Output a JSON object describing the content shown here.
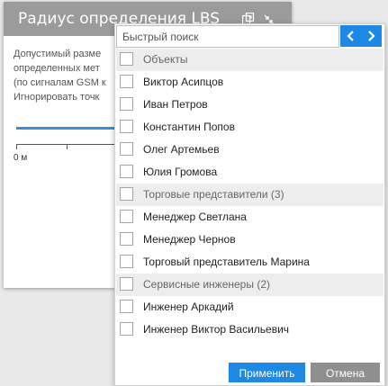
{
  "dialog": {
    "title": "Радиус определения LBS",
    "description_lines": [
      "Допустимый разме",
      "определенных мет",
      "(по сигналам GSM к",
      "Игнорировать точк"
    ],
    "scale_label": "0 м"
  },
  "dropdown": {
    "search_placeholder": "Быстрый поиск",
    "items": [
      {
        "label": "Объекты",
        "kind": "group"
      },
      {
        "label": "Виктор Асипцов",
        "kind": "item"
      },
      {
        "label": "Иван Петров",
        "kind": "item"
      },
      {
        "label": "Константин Попов",
        "kind": "item"
      },
      {
        "label": "Олег Артемьев",
        "kind": "item"
      },
      {
        "label": "Юлия Громова",
        "kind": "item"
      },
      {
        "label": "Торговые представители (3)",
        "kind": "group"
      },
      {
        "label": "Менеджер Светлана",
        "kind": "item"
      },
      {
        "label": "Менеджер Чернов",
        "kind": "item"
      },
      {
        "label": "Торговый представитель Марина",
        "kind": "item"
      },
      {
        "label": "Сервисные инженеры (2)",
        "kind": "group"
      },
      {
        "label": "Инженер Аркадий",
        "kind": "item"
      },
      {
        "label": "Инженер Виктор Васильевич",
        "kind": "item"
      }
    ],
    "apply_label": "Применить",
    "cancel_label": "Отмена"
  },
  "icons": {
    "copy": "copy-icon",
    "collapse": "collapse-icon",
    "prev": "chevron-left-icon",
    "next": "chevron-right-icon"
  },
  "colors": {
    "accent": "#1e88e5",
    "header": "#9b9b9b",
    "cancel": "#8f8f8f",
    "group_row": "#ededed",
    "slider": "#3c8dd8"
  }
}
